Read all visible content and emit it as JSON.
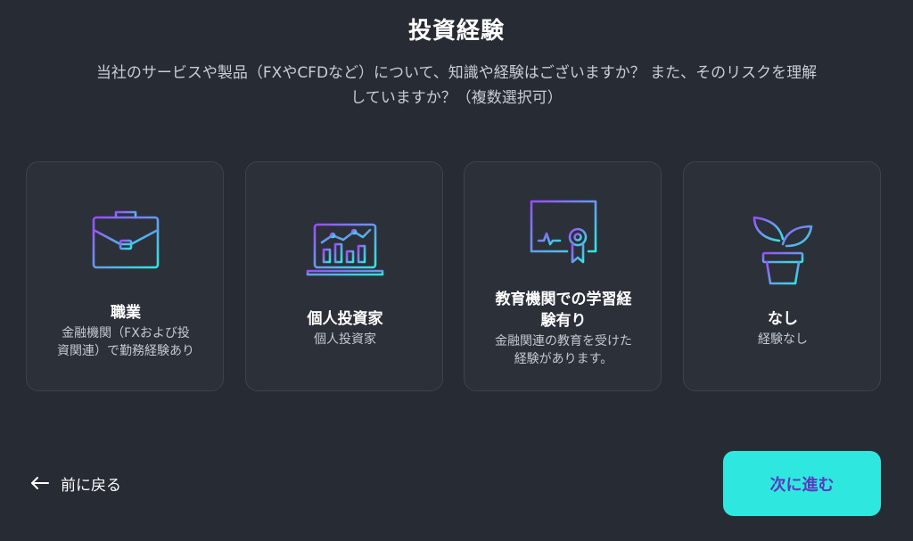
{
  "header": {
    "title": "投資経験",
    "description_line1": "当社のサービスや製品（FXやCFDなど）について、知識や経験はございますか？ また、そのリスクを理解",
    "description_line2": "していますか？（複数選択可）"
  },
  "options": [
    {
      "icon": "briefcase-icon",
      "title": "職業",
      "subtitle_line1": "金融機関（FXおよび投",
      "subtitle_line2": "資関連）で勤務経験あり"
    },
    {
      "icon": "laptop-chart-icon",
      "title": "個人投資家",
      "subtitle_line1": "個人投資家"
    },
    {
      "icon": "certificate-icon",
      "title_line1": "教育機関での学習経",
      "title_line2": "験有り",
      "subtitle_line1": "金融関連の教育を受けた",
      "subtitle_line2": "経験があります。"
    },
    {
      "icon": "plant-pot-icon",
      "title": "なし",
      "subtitle_line1": "経験なし"
    }
  ],
  "footer": {
    "back_label": "前に戻る",
    "next_label": "次に進む"
  },
  "colors": {
    "background": "#272b33",
    "card_background": "#2c3038",
    "accent_button": "#2ee8e0",
    "button_text": "#5a3bbf",
    "icon_gradient_start": "#9b4dff",
    "icon_gradient_end": "#2ee8e0"
  }
}
